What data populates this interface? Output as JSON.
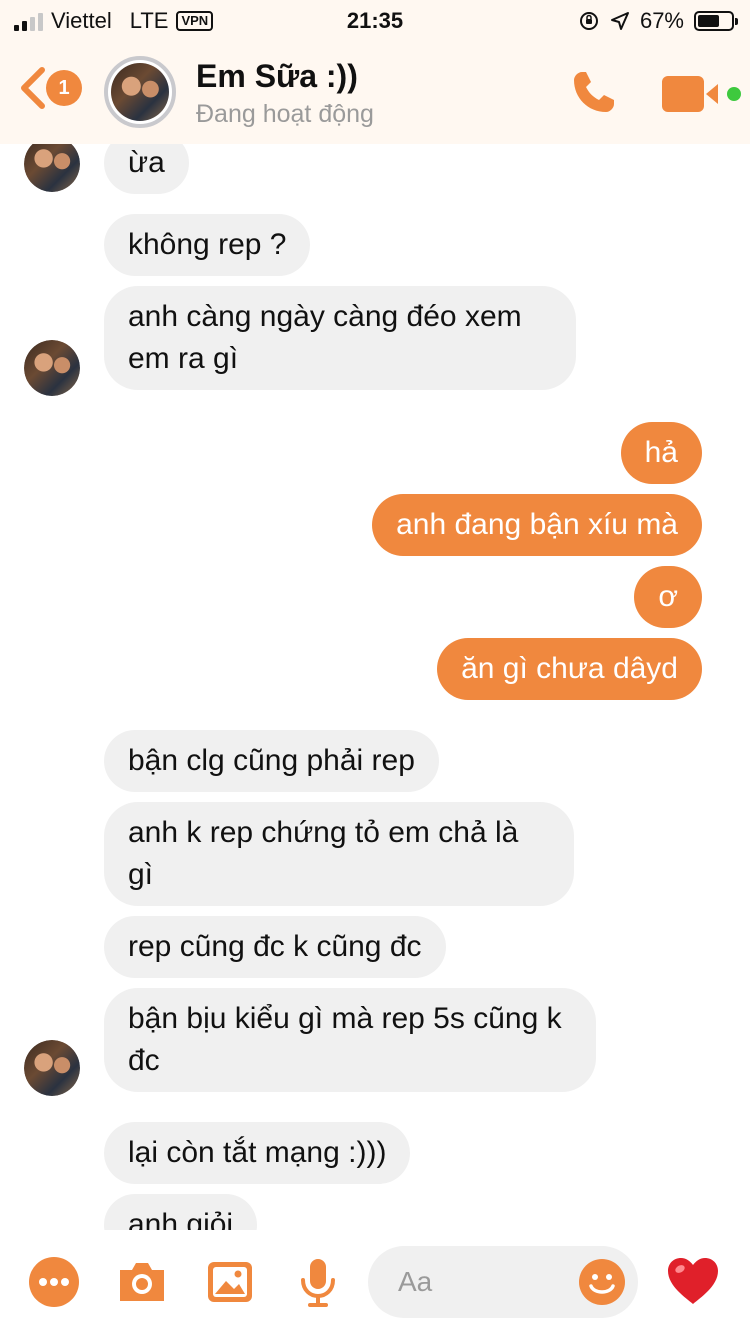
{
  "status_bar": {
    "carrier": "Viettel",
    "network": "LTE",
    "vpn": "VPN",
    "time": "21:35",
    "battery": "67%",
    "battery_level": 0.67
  },
  "header": {
    "back_badge": "1",
    "contact_name": "Em Sữa :))",
    "contact_status": "Đang hoạt động"
  },
  "messages": [
    {
      "side": "in",
      "text": "ừa"
    },
    {
      "side": "in",
      "text": "không rep ?"
    },
    {
      "side": "in",
      "text": "anh càng ngày càng đéo xem em ra gì"
    },
    {
      "side": "out",
      "text": "hả"
    },
    {
      "side": "out",
      "text": "anh đang bận xíu mà"
    },
    {
      "side": "out",
      "text": "ơ"
    },
    {
      "side": "out",
      "text": "ăn gì chưa dâyd"
    },
    {
      "side": "in",
      "text": "bận clg cũng phải rep"
    },
    {
      "side": "in",
      "text": "anh k rep chứng tỏ em chả là gì"
    },
    {
      "side": "in",
      "text": "rep cũng đc k cũng đc"
    },
    {
      "side": "in",
      "text": "bận bịu kiểu gì mà rep 5s cũng k đc"
    },
    {
      "side": "in",
      "text": "lại còn tắt mạng :)))"
    },
    {
      "side": "in",
      "text": "anh giỏi"
    }
  ],
  "composer": {
    "placeholder": "Aa"
  },
  "colors": {
    "accent": "#f0883e",
    "incoming_bubble": "#f0f0f0",
    "online_dot": "#3ec93e"
  }
}
